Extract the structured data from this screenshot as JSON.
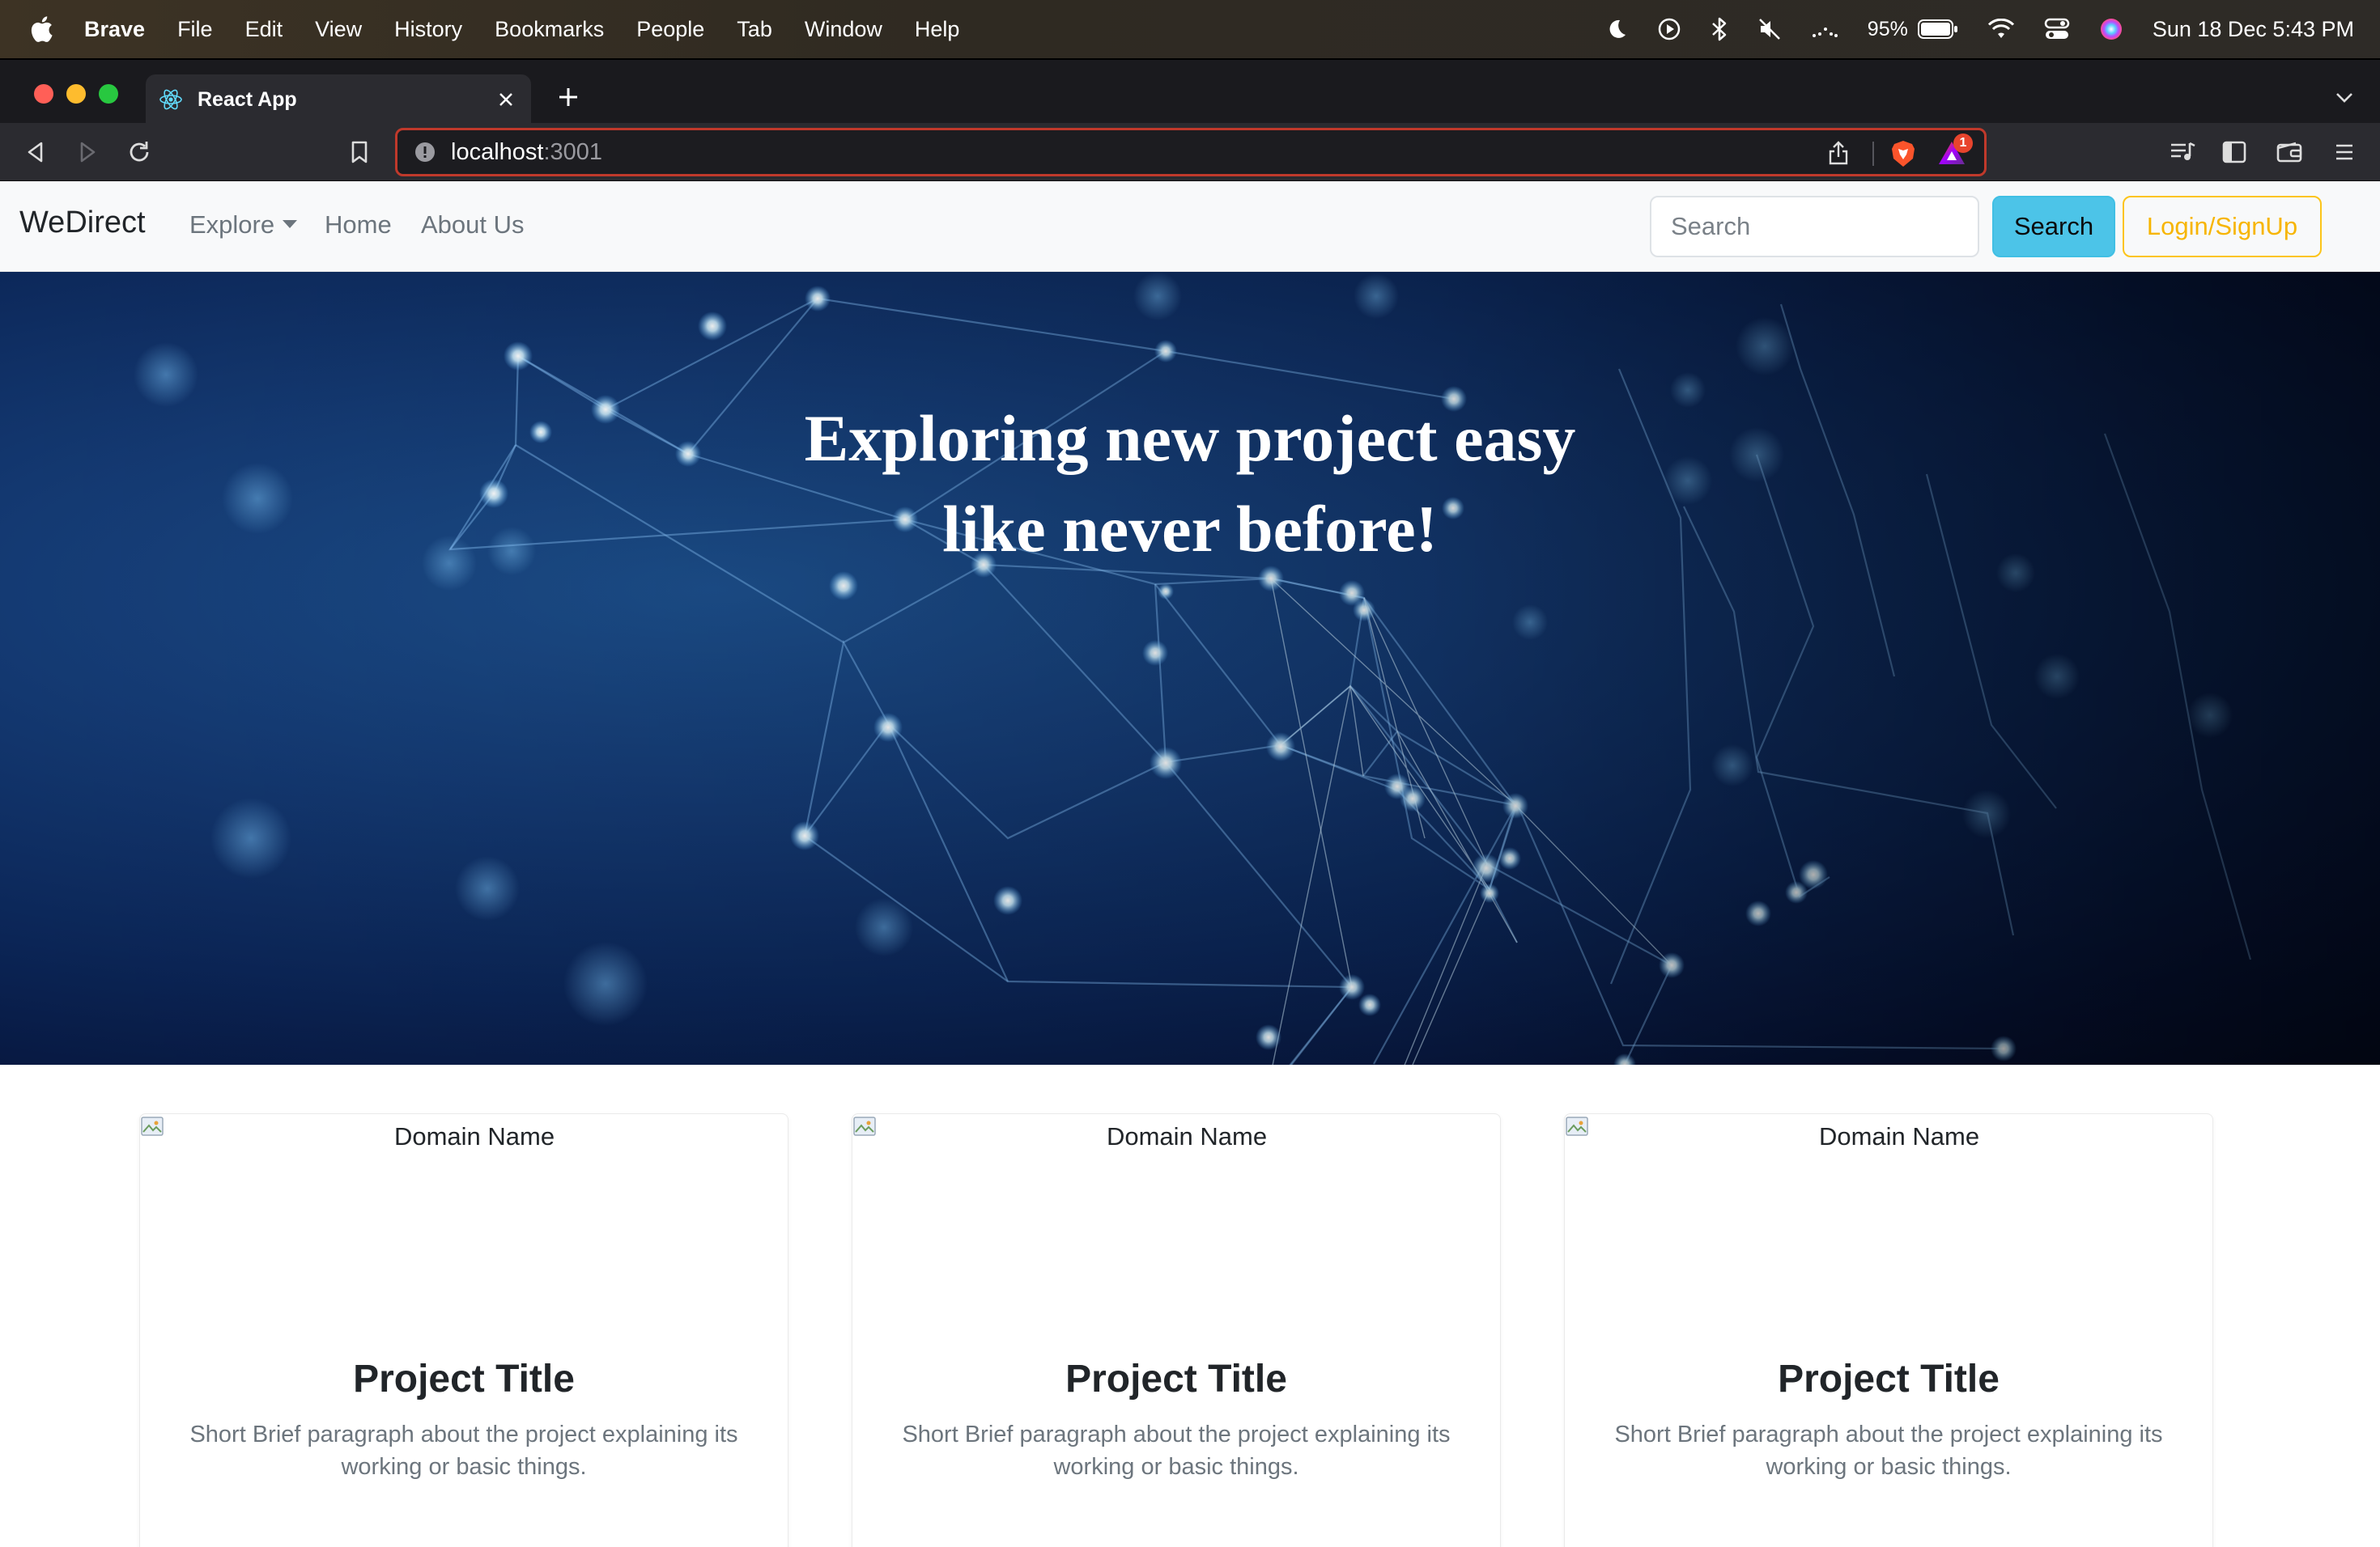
{
  "menubar": {
    "app_name": "Brave",
    "items": [
      "File",
      "Edit",
      "View",
      "History",
      "Bookmarks",
      "People",
      "Tab",
      "Window",
      "Help"
    ],
    "battery": "95%",
    "clock": "Sun 18 Dec  5:43 PM"
  },
  "browser": {
    "tab_title": "React App",
    "url_host": "localhost",
    "url_port": ":3001",
    "rewards_badge": "1",
    "address_border_color": "#c0392b"
  },
  "navbar": {
    "brand": "WeDirect",
    "explore": "Explore",
    "home": "Home",
    "about": "About Us",
    "search_placeholder": "Search",
    "search_button": "Search",
    "login_button": "Login/SignUp",
    "accent_search": "#4cc4e8",
    "accent_login": "#f7b500"
  },
  "hero": {
    "title_line1": "Exploring new project easy",
    "title_line2": "like never before!"
  },
  "cards": [
    {
      "img_alt": "Domain Name",
      "title": "Project Title",
      "text": "Short Brief paragraph about the project explaining its working or basic things."
    },
    {
      "img_alt": "Domain Name",
      "title": "Project Title",
      "text": "Short Brief paragraph about the project explaining its working or basic things."
    },
    {
      "img_alt": "Domain Name",
      "title": "Project Title",
      "text": "Short Brief paragraph about the project explaining its working or basic things."
    }
  ]
}
